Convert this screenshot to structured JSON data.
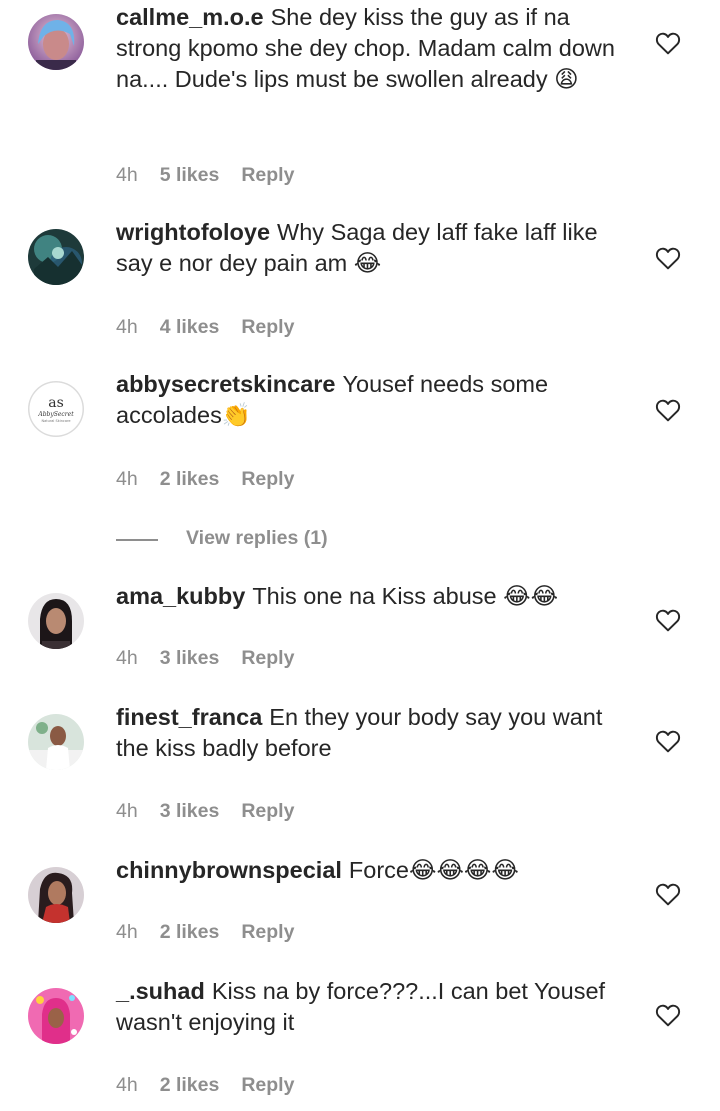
{
  "comments": [
    {
      "username": "callme_m.o.e",
      "text": "She dey kiss the guy as if na strong kpomo she dey chop. Madam calm down na.... Dude's lips must be swollen already ",
      "emoji": "😩",
      "time": "4h",
      "likes": "5 likes",
      "reply": "Reply"
    },
    {
      "username": "wrightofoloye",
      "text": "Why Saga dey laff fake laff like say e nor dey pain am ",
      "emoji": "😂",
      "time": "4h",
      "likes": "4 likes",
      "reply": "Reply"
    },
    {
      "username": "abbysecretskincare",
      "text": "Yousef needs some accolades",
      "emoji": "👏",
      "time": "4h",
      "likes": "2 likes",
      "reply": "Reply"
    },
    {
      "username": "ama_kubby",
      "text": "This one na Kiss abuse ",
      "emoji": "😂😂",
      "time": "4h",
      "likes": "3 likes",
      "reply": "Reply"
    },
    {
      "username": "finest_franca",
      "text": "En they your body say you want the kiss badly before",
      "emoji": "",
      "time": "4h",
      "likes": "3 likes",
      "reply": "Reply"
    },
    {
      "username": "chinnybrownspecial",
      "text": "Force",
      "emoji": "😂😂😂😂",
      "time": "4h",
      "likes": "2 likes",
      "reply": "Reply"
    },
    {
      "username": "_.suhad",
      "text": "Kiss na by force???...I can bet Yousef wasn't enjoying it",
      "emoji": "",
      "time": "4h",
      "likes": "2 likes",
      "reply": "Reply"
    }
  ],
  "view_replies": {
    "label": "View replies (1)"
  },
  "avatar_logo": {
    "mark": "as",
    "name": "AbbySecret",
    "sub": "Natural Skincare"
  },
  "icons": {
    "like": "heart-outline-icon"
  },
  "colors": {
    "text": "#262626",
    "secondary": "#8e8e8e",
    "background": "#ffffff"
  }
}
